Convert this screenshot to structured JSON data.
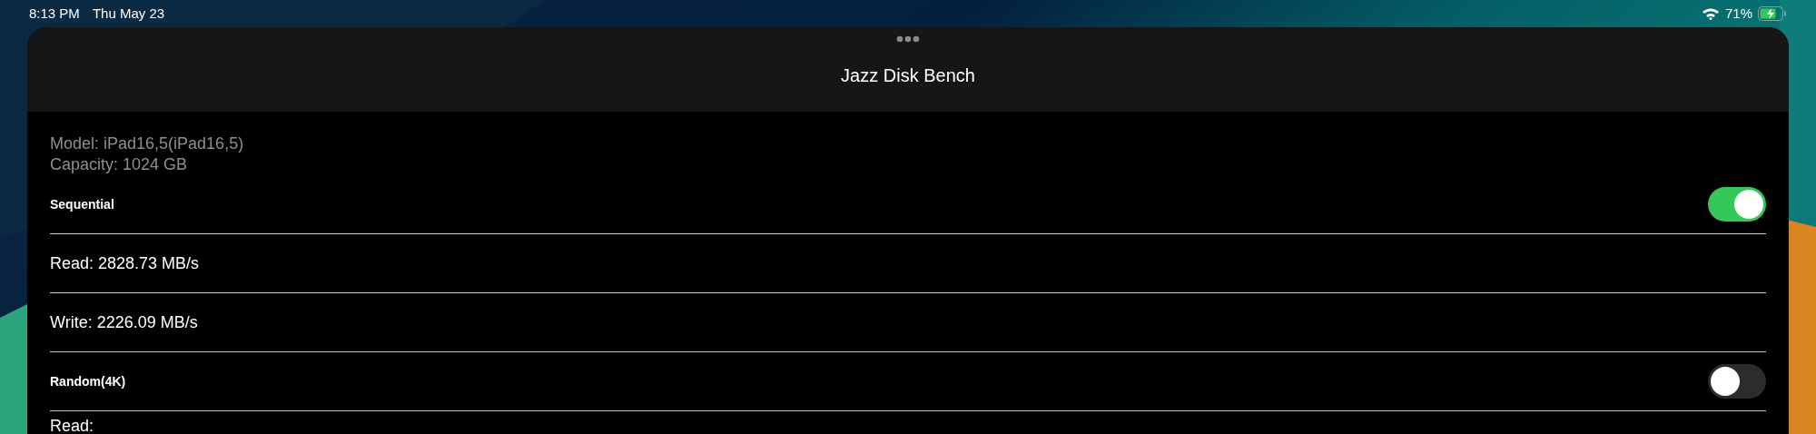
{
  "status_bar": {
    "time": "8:13 PM",
    "date": "Thu May 23",
    "battery": "71%"
  },
  "window": {
    "title": "Jazz Disk Bench"
  },
  "device_info": [
    "Model: iPad16,5(iPad16,5)",
    "Capacity: 1024 GB"
  ],
  "rows": [
    {
      "kind": "header",
      "label": "Sequential",
      "on": true
    },
    {
      "kind": "value",
      "label": "Read: 2828.73 MB/s"
    },
    {
      "kind": "value",
      "label": "Write: 2226.09 MB/s"
    },
    {
      "kind": "header",
      "label": "Random(4K)",
      "on": false
    },
    {
      "kind": "value",
      "label": "Read:"
    }
  ]
}
